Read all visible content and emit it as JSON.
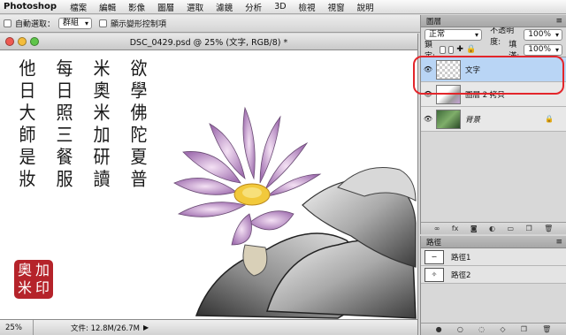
{
  "menubar": {
    "app": "Photoshop",
    "items": [
      "檔案",
      "編輯",
      "影像",
      "圖層",
      "選取",
      "濾鏡",
      "分析",
      "3D",
      "檢視",
      "視窗",
      "說明"
    ]
  },
  "options": {
    "auto_select_label": "自動選取：",
    "auto_select_value": "群組",
    "transform_label": "顯示變形控制項"
  },
  "document": {
    "title": "DSC_0429.psd @ 25% (文字, RGB/8) *",
    "zoom": "25%",
    "file_info": "文件: 12.8M/26.7M",
    "columns": [
      [
        "欲",
        "學",
        "佛",
        "陀",
        "夏",
        "普"
      ],
      [
        "米",
        "奧",
        "米",
        "加",
        "研",
        "讀"
      ],
      [
        "每",
        "日",
        "照",
        "三",
        "餐",
        "服"
      ],
      [
        "他",
        "日",
        "大",
        "師",
        "是",
        "妝"
      ]
    ],
    "seal": [
      "加",
      "奧",
      "印",
      "米"
    ]
  },
  "layers_panel": {
    "tab": "圖層",
    "blend_mode": "正常",
    "opacity_label": "不透明度:",
    "opacity_value": "100%",
    "lock_label": "鎖定:",
    "fill_label": "填滿:",
    "fill_value": "100%",
    "layers": [
      {
        "name": "文字",
        "selected": true
      },
      {
        "name": "圖層 2 拷貝",
        "selected": false
      },
      {
        "name": "背景",
        "selected": false
      }
    ]
  },
  "paths_panel": {
    "tab": "路徑",
    "paths": [
      "路徑1",
      "路徑2"
    ]
  },
  "colors": {
    "selection": "#b9d5f5",
    "highlight": "#e3262b",
    "seal": "#b5232a"
  }
}
